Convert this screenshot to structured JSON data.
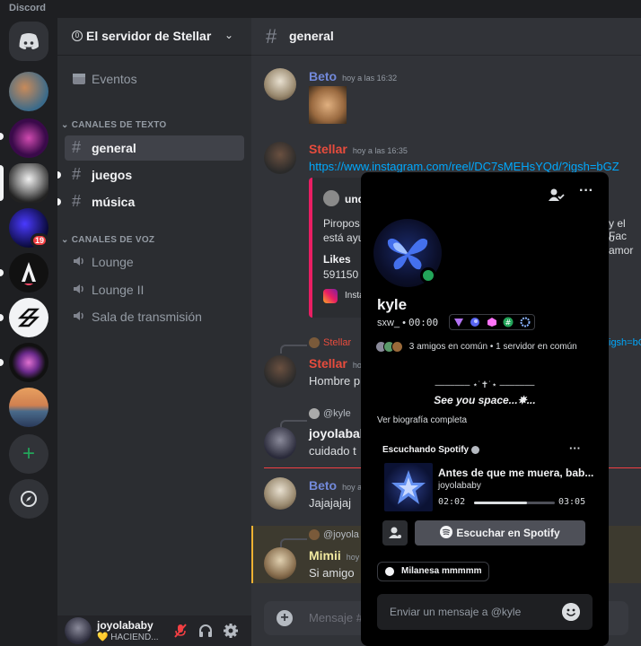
{
  "app": {
    "title": "Discord"
  },
  "server": {
    "name": "El servidor de Stellar",
    "boost_level": "0"
  },
  "sidebar": {
    "events_label": "Eventos",
    "text_category": "CANALES DE TEXTO",
    "voice_category": "CANALES DE VOZ",
    "text_channels": [
      {
        "name": "general",
        "active": true
      },
      {
        "name": "juegos",
        "unread": true
      },
      {
        "name": "música",
        "unread": true
      }
    ],
    "voice_channels": [
      "Lounge",
      "Lounge II",
      "Sala de transmisión"
    ]
  },
  "rail": {
    "mention_badge": "19"
  },
  "user_panel": {
    "username": "joyolababy",
    "status": "💛 HACIEND..."
  },
  "channel": {
    "name": "general"
  },
  "messages": [
    {
      "author": "Beto",
      "time": "hoy a las 16:32",
      "color": "#7289da"
    },
    {
      "author": "Stellar",
      "time": "hoy a las 16:35",
      "color": "#e84c3d",
      "text": "https://www.instagram.com/reel/DC7sMEHsYQd/?igsh=bGZ"
    },
    {
      "reply_to": "Stellar",
      "reply_tail": "igsh=bG",
      "author": "Stellar",
      "time": "ho",
      "text": "Hombre p"
    },
    {
      "reply_to": "@kyle",
      "author": "joyolabab",
      "text": "cuidado t"
    },
    {
      "author": "Beto",
      "time": "hoy a",
      "text": "Jajajajaj"
    },
    {
      "reply_to": "@joyola",
      "author": "Mimii",
      "time": "hoy",
      "text": "Si amigo"
    }
  ],
  "embed": {
    "author": "und",
    "desc_line1": "Piropos",
    "desc_line2": "está ayu",
    "desc_tail1": "y el Fac",
    "desc_tail2": "o amor",
    "field_name": "Likes",
    "field_value": "591150",
    "footer": "Insta"
  },
  "composer": {
    "placeholder": "Mensaje #"
  },
  "profile": {
    "display_name": "kyle",
    "handle": "sxw_",
    "clock": "00:00",
    "mutual": "3 amigos en común • 1 servidor en común",
    "bio_line1": "‒‒‒‒‒‒‒ ⋆˙✝˙⋆ ‒‒‒‒‒‒‒",
    "bio_line2": "See you space...✵...",
    "bio_link": "Ver biografía completa",
    "activity_title": "Escuchando Spotify",
    "song": "Antes de que me muera, bab...",
    "artist": "joyolababy",
    "elapsed": "02:02",
    "duration": "03:05",
    "progress": 0.66,
    "spotify_button": "Escuchar en Spotify",
    "custom_status": "Milanesa mmmmm",
    "message_placeholder": "Enviar un mensaje a @kyle"
  },
  "colors": {
    "accent": "#5865f2",
    "online": "#23a55a",
    "mention": "#f23f43",
    "embed_bar": "#e91e63"
  }
}
